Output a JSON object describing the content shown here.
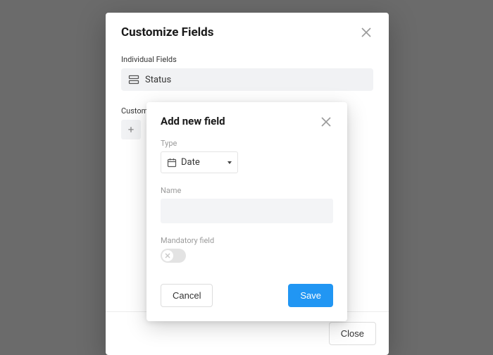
{
  "mainModal": {
    "title": "Customize Fields",
    "individualLabel": "Individual Fields",
    "statusItem": "Status",
    "customLabel": "Custom Fields",
    "closeLabel": "Close"
  },
  "innerModal": {
    "title": "Add new field",
    "typeLabel": "Type",
    "typeValue": "Date",
    "nameLabel": "Name",
    "nameValue": "",
    "mandatoryLabel": "Mandatory field",
    "mandatoryOn": false,
    "cancelLabel": "Cancel",
    "saveLabel": "Save"
  }
}
